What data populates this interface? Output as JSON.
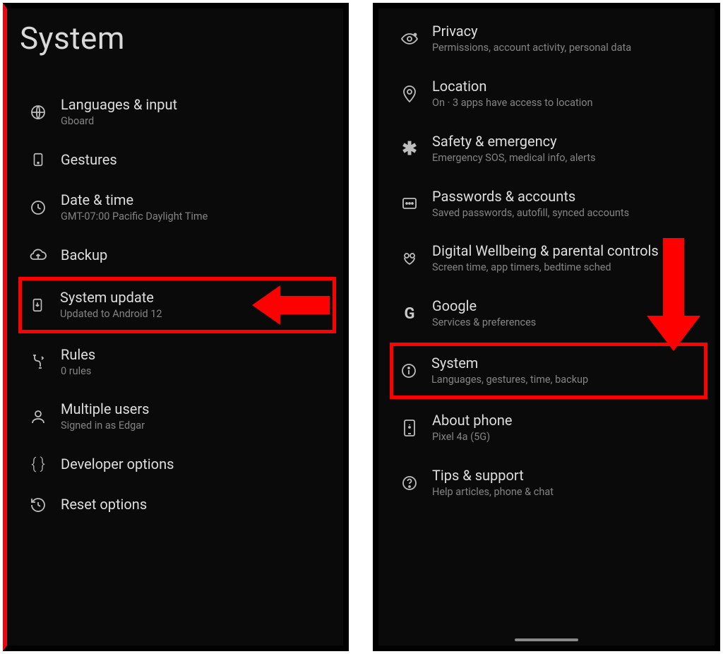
{
  "left": {
    "title": "System",
    "items": [
      {
        "icon": "language-icon",
        "title": "Languages & input",
        "subtitle": "Gboard",
        "highlight": false
      },
      {
        "icon": "gestures-icon",
        "title": "Gestures",
        "subtitle": "",
        "highlight": false
      },
      {
        "icon": "clock-icon",
        "title": "Date & time",
        "subtitle": "GMT-07:00 Pacific Daylight Time",
        "highlight": false
      },
      {
        "icon": "cloud-upload-icon",
        "title": "Backup",
        "subtitle": "",
        "highlight": false
      },
      {
        "icon": "system-update-icon",
        "title": "System update",
        "subtitle": "Updated to Android 12",
        "highlight": true
      },
      {
        "icon": "rules-icon",
        "title": "Rules",
        "subtitle": "0 rules",
        "highlight": false
      },
      {
        "icon": "users-icon",
        "title": "Multiple users",
        "subtitle": "Signed in as Edgar",
        "highlight": false
      },
      {
        "icon": "braces-icon",
        "title": "Developer options",
        "subtitle": "",
        "highlight": false
      },
      {
        "icon": "reset-icon",
        "title": "Reset options",
        "subtitle": "",
        "highlight": false
      }
    ]
  },
  "right": {
    "items": [
      {
        "icon": "privacy-icon",
        "title": "Privacy",
        "subtitle": "Permissions, account activity, personal data",
        "highlight": false
      },
      {
        "icon": "location-icon",
        "title": "Location",
        "subtitle": "On · 3 apps have access to location",
        "highlight": false
      },
      {
        "icon": "safety-icon",
        "title": "Safety & emergency",
        "subtitle": "Emergency SOS, medical info, alerts",
        "highlight": false
      },
      {
        "icon": "passwords-icon",
        "title": "Passwords & accounts",
        "subtitle": "Saved passwords, autofill, synced accounts",
        "highlight": false
      },
      {
        "icon": "wellbeing-icon",
        "title": "Digital Wellbeing & parental controls",
        "subtitle": "Screen time, app timers, bedtime sched",
        "highlight": false
      },
      {
        "icon": "google-icon",
        "title": "Google",
        "subtitle": "Services & preferences",
        "highlight": false
      },
      {
        "icon": "info-icon",
        "title": "System",
        "subtitle": "Languages, gestures, time, backup",
        "highlight": true
      },
      {
        "icon": "phone-icon",
        "title": "About phone",
        "subtitle": "Pixel 4a (5G)",
        "highlight": false
      },
      {
        "icon": "help-icon",
        "title": "Tips & support",
        "subtitle": "Help articles, phone & chat",
        "highlight": false
      }
    ]
  },
  "colors": {
    "highlight": "#ff0000",
    "bg": "#0a0a0a"
  }
}
